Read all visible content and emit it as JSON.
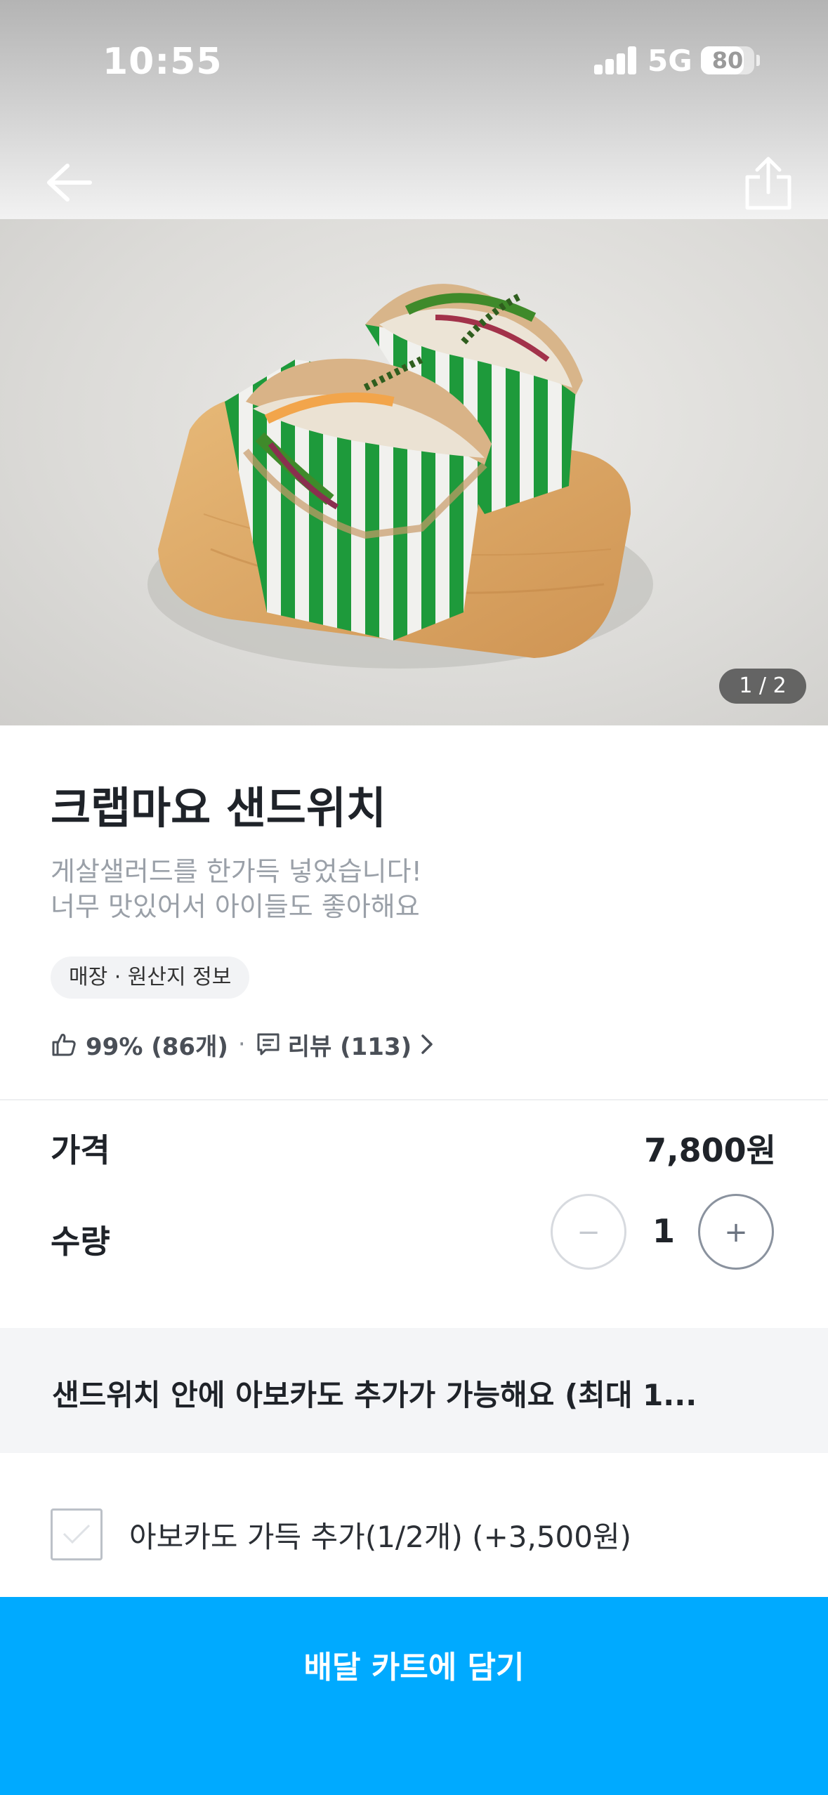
{
  "status_bar": {
    "time": "10:55",
    "network": "5G",
    "battery": "80",
    "battery_level": 0.8
  },
  "nav": {
    "back_icon": "arrow-left-icon",
    "share_icon": "share-icon"
  },
  "gallery": {
    "counter": "1 / 2",
    "current": 1,
    "total": 2
  },
  "product": {
    "name": "크랩마요 샌드위치",
    "description": [
      "게살샐러드를 한가득 넣었습니다!",
      "너무 맛있어서 아이들도 좋아해요"
    ],
    "info_chip": "매장 · 원산지 정보",
    "rating": "99% (86개)",
    "separator": "·",
    "reviews": "리뷰 (113)"
  },
  "order": {
    "price_label": "가격",
    "price": "7,800원",
    "quantity_label": "수량",
    "quantity": "1",
    "minus": "−",
    "plus": "+"
  },
  "options": {
    "header": "샌드위치 안에 아보카도 추가가 가능해요 (최대 1...",
    "items": [
      {
        "label": "아보카도 가득 추가(1/2개) (+3,500원)",
        "checked": false
      }
    ]
  },
  "cta": {
    "label": "배달 카트에 담기"
  },
  "colors": {
    "accent": "#00aaff",
    "muted_text": "#9aa0a8"
  }
}
